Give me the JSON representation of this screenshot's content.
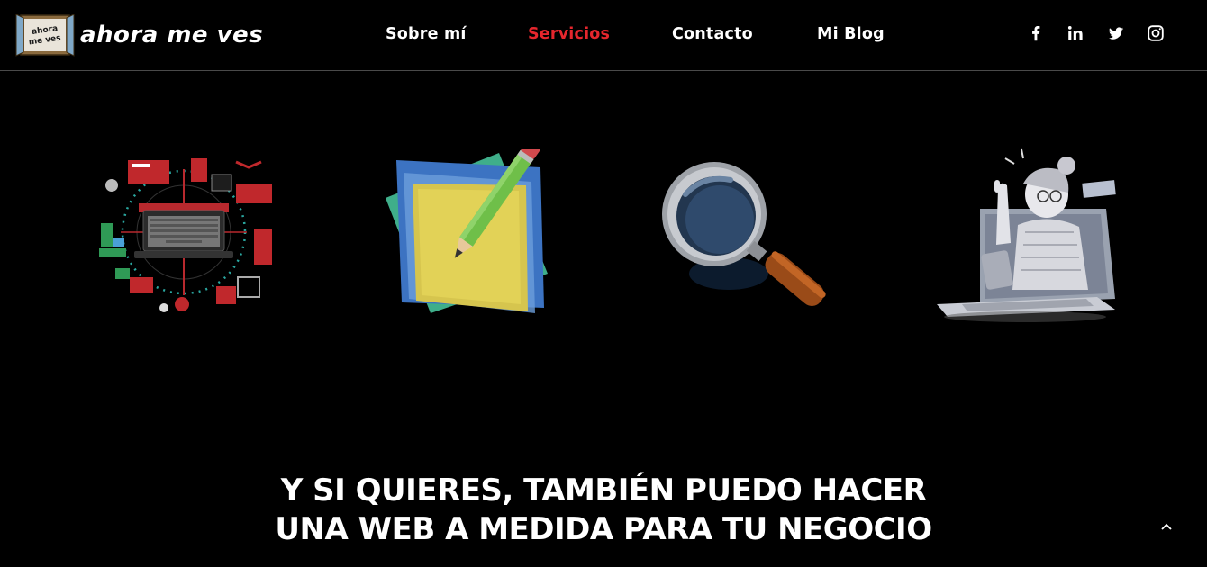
{
  "brand": {
    "logo_sign_line1": "ahora",
    "logo_sign_line2": "me ves",
    "name": "ahora me ves"
  },
  "nav": {
    "items": [
      {
        "label": "Sobre mí",
        "active": false
      },
      {
        "label": "Servicios",
        "active": true
      },
      {
        "label": "Contacto",
        "active": false
      },
      {
        "label": "Mi Blog",
        "active": false
      }
    ],
    "active_color": "#e5262d"
  },
  "social": [
    "facebook-icon",
    "linkedin-icon",
    "twitter-icon",
    "instagram-icon"
  ],
  "features": [
    {
      "icon": "digital-marketing-illustration"
    },
    {
      "icon": "sticky-notes-pencil-illustration"
    },
    {
      "icon": "magnifying-glass-illustration"
    },
    {
      "icon": "online-teacher-laptop-illustration"
    }
  ],
  "cta": {
    "line1": "Y SI QUIERES, TAMBIÉN PUEDO HACER",
    "line2": "UNA WEB A MEDIDA PARA TU NEGOCIO"
  },
  "scroll_top_icon": "chevron-up-icon"
}
